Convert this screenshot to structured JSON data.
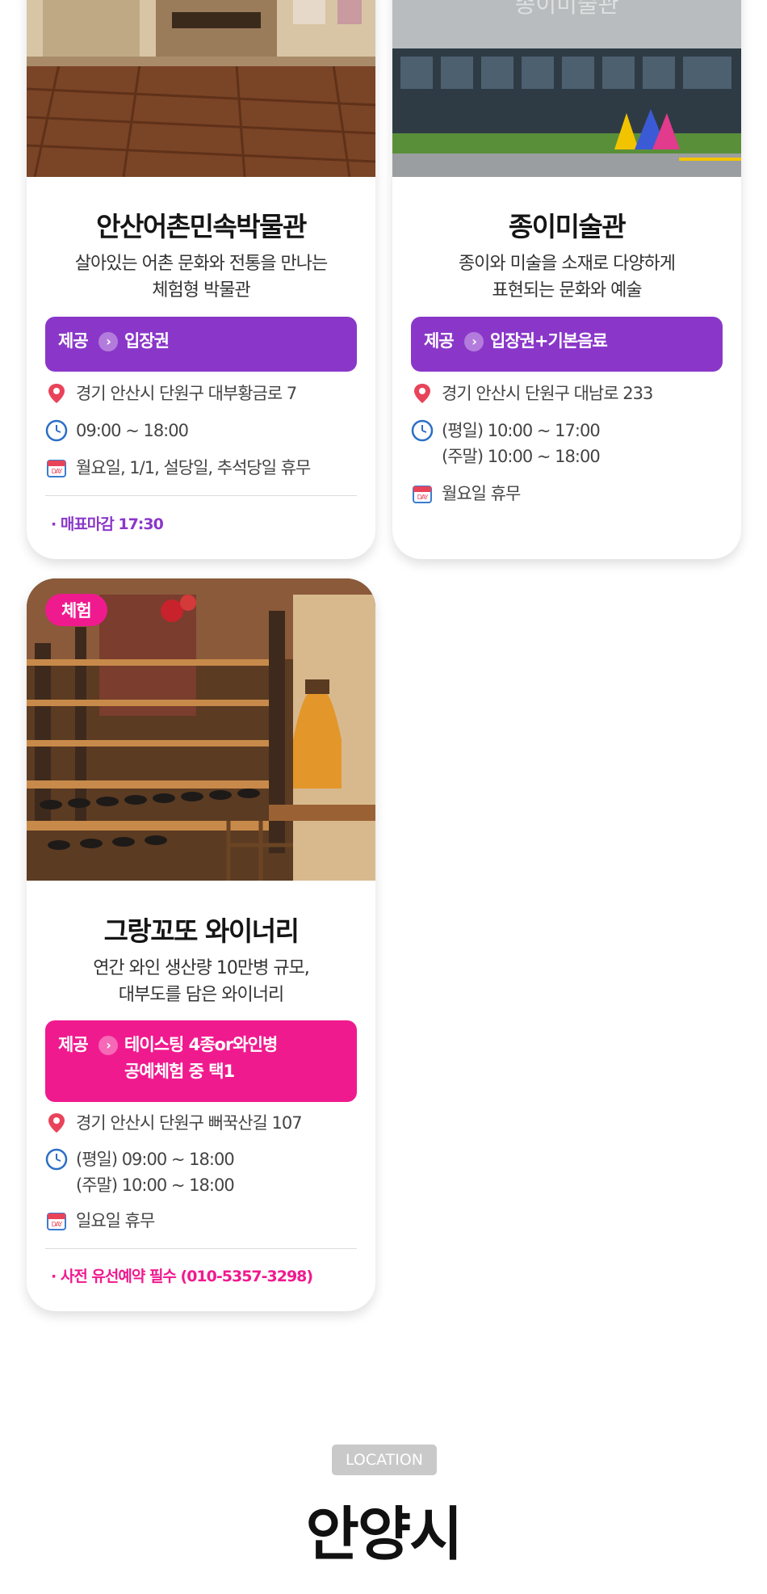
{
  "cards": [
    {
      "title": "안산어촌민속박물관",
      "desc_line1": "살아있는 어촌 문화와 전통을 만나는",
      "desc_line2": "체험형 박물관",
      "provide_label": "제공",
      "provide_value": "입장권",
      "address": "경기 안산시 단원구 대부황금로 7",
      "hours": "09:00 ~ 18:00",
      "closed": "월요일, 1/1, 설당일, 추석당일 휴무",
      "note": "· 매표마감 17:30",
      "accent": "#8a37c9"
    },
    {
      "title": "종이미술관",
      "desc_line1": "종이와 미술을 소재로 다양하게",
      "desc_line2": "표현되는 문화와 예술",
      "provide_label": "제공",
      "provide_value": "입장권+기본음료",
      "address": "경기 안산시 단원구 대남로 233",
      "hours_line1": "(평일) 10:00 ~ 17:00",
      "hours_line2": "(주말) 10:00 ~ 18:00",
      "closed": "월요일 휴무",
      "accent": "#8a37c9"
    },
    {
      "badge": "체험",
      "title": "그랑꼬또 와이너리",
      "desc_line1": "연간 와인 생산량 10만병 규모,",
      "desc_line2": "대부도를 담은 와이너리",
      "provide_label": "제공",
      "provide_value_line1": "테이스팅 4종or와인병",
      "provide_value_line2": "공예체험 중 택1",
      "address": "경기 안산시 단원구 뻐꾹산길 107",
      "hours_line1": "(평일) 09:00 ~ 18:00",
      "hours_line2": "(주말) 10:00 ~ 18:00",
      "closed": "일요일 휴무",
      "note": "· 사전 유선예약 필수 (010-5357-3298)",
      "accent": "#f01a8f"
    }
  ],
  "location_tag": "LOCATION",
  "city": "안양시",
  "icons": {
    "address": "map-pin-icon",
    "hours": "clock-icon",
    "closed": "calendar-icon",
    "chevron": "chevron-right-icon"
  }
}
